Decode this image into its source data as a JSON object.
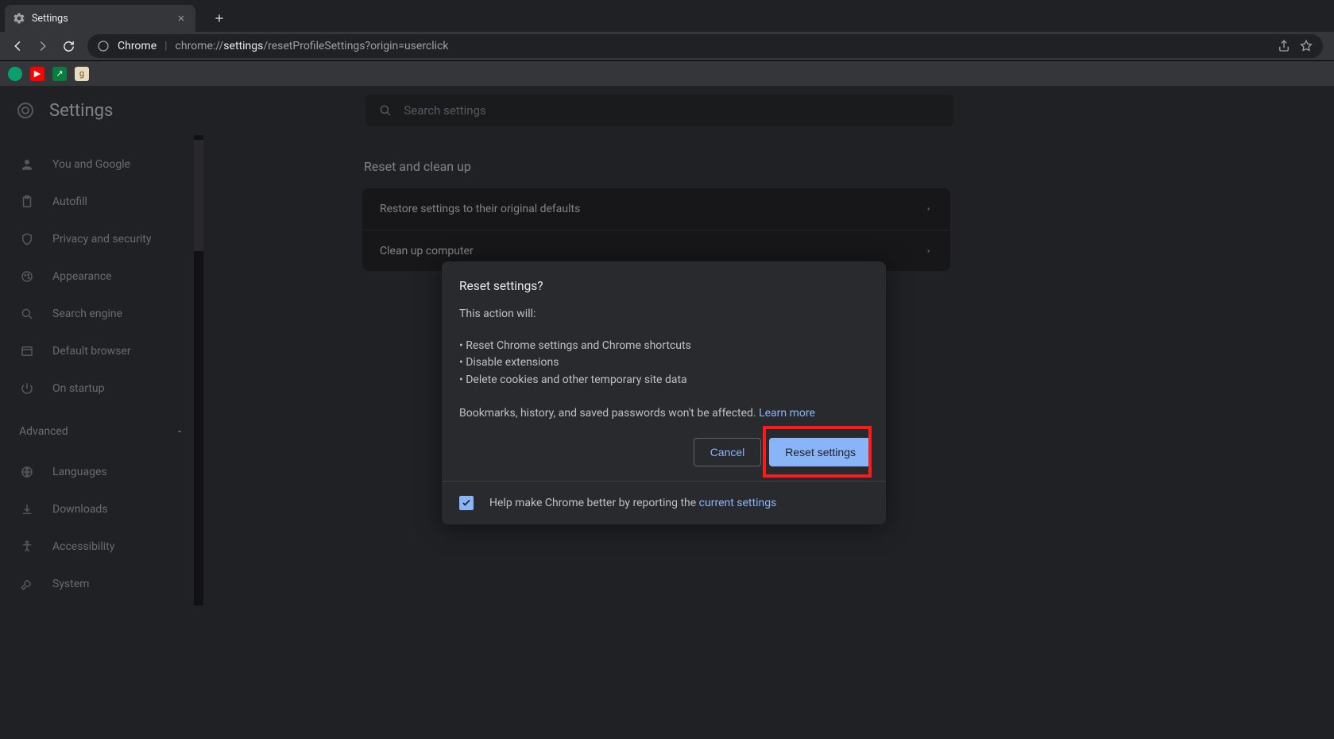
{
  "browser": {
    "tab_title": "Settings",
    "omnibox": {
      "origin_label": "Chrome",
      "url_prefix": "chrome://",
      "url_highlight": "settings",
      "url_suffix": "/resetProfileSettings?origin=userclick"
    }
  },
  "settings_app": {
    "header_title": "Settings",
    "search_placeholder": "Search settings",
    "sidebar": {
      "items": [
        {
          "label": "You and Google"
        },
        {
          "label": "Autofill"
        },
        {
          "label": "Privacy and security"
        },
        {
          "label": "Appearance"
        },
        {
          "label": "Search engine"
        },
        {
          "label": "Default browser"
        },
        {
          "label": "On startup"
        }
      ],
      "advanced_label": "Advanced",
      "advanced_items": [
        {
          "label": "Languages"
        },
        {
          "label": "Downloads"
        },
        {
          "label": "Accessibility"
        },
        {
          "label": "System"
        }
      ]
    },
    "content": {
      "section_title": "Reset and clean up",
      "rows": [
        {
          "label": "Restore settings to their original defaults"
        },
        {
          "label": "Clean up computer"
        }
      ]
    }
  },
  "dialog": {
    "title": "Reset settings?",
    "lead": "This action will:",
    "bullets": [
      "Reset Chrome settings and Chrome shortcuts",
      "Disable extensions",
      "Delete cookies and other temporary site data"
    ],
    "note_text": "Bookmarks, history, and saved passwords won't be affected. ",
    "learn_more": "Learn more",
    "cancel": "Cancel",
    "confirm": "Reset settings",
    "footer_text": "Help make Chrome better by reporting the ",
    "footer_link": "current settings",
    "checkbox_checked": true
  }
}
